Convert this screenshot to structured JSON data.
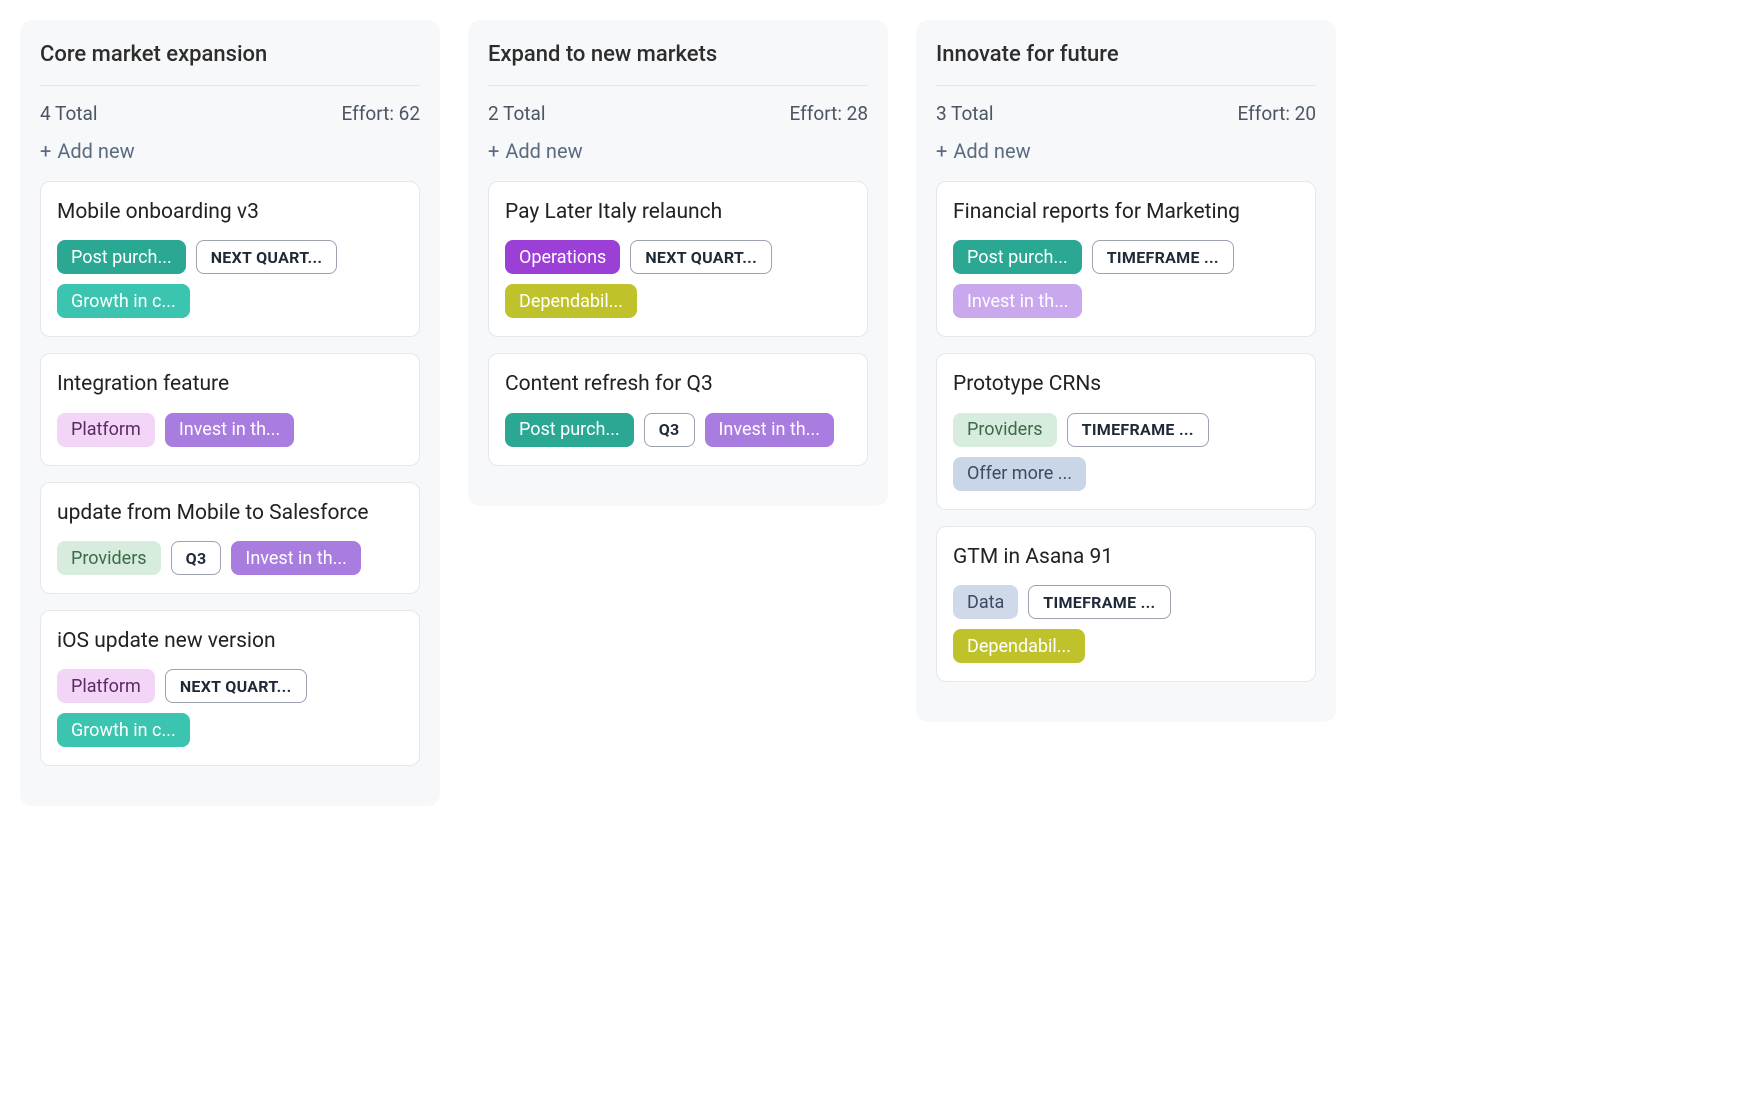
{
  "labels": {
    "add_new": "Add new",
    "total_suffix": "Total",
    "effort_prefix": "Effort:"
  },
  "columns": [
    {
      "title": "Core market expansion",
      "total": 4,
      "effort": 62,
      "cards": [
        {
          "title": "Mobile onboarding v3",
          "tags": [
            {
              "text": "Post purch...",
              "variant": "teal"
            },
            {
              "text": "NEXT QUART...",
              "variant": "outline"
            },
            {
              "text": "Growth in c...",
              "variant": "mint"
            }
          ]
        },
        {
          "title": "Integration feature",
          "tags": [
            {
              "text": "Platform",
              "variant": "pink"
            },
            {
              "text": "Invest in th...",
              "variant": "purple"
            }
          ]
        },
        {
          "title": "update from Mobile to Salesforce",
          "tags": [
            {
              "text": "Providers",
              "variant": "green-lt"
            },
            {
              "text": "Q3",
              "variant": "outline small-outline"
            },
            {
              "text": "Invest in th...",
              "variant": "purple"
            }
          ]
        },
        {
          "title": "iOS update new version",
          "tags": [
            {
              "text": "Platform",
              "variant": "pink"
            },
            {
              "text": "NEXT QUART...",
              "variant": "outline"
            },
            {
              "text": "Growth in c...",
              "variant": "mint"
            }
          ]
        }
      ]
    },
    {
      "title": "Expand to new markets",
      "total": 2,
      "effort": 28,
      "cards": [
        {
          "title": "Pay Later Italy relaunch",
          "tags": [
            {
              "text": "Operations",
              "variant": "violet"
            },
            {
              "text": "NEXT QUART...",
              "variant": "outline"
            },
            {
              "text": "Dependabil...",
              "variant": "olive"
            }
          ]
        },
        {
          "title": "Content refresh for Q3",
          "tags": [
            {
              "text": "Post purch...",
              "variant": "teal"
            },
            {
              "text": "Q3",
              "variant": "outline small-outline"
            },
            {
              "text": "Invest in th...",
              "variant": "purple"
            }
          ]
        }
      ]
    },
    {
      "title": "Innovate for future",
      "total": 3,
      "effort": 20,
      "cards": [
        {
          "title": "Financial reports for Marketing",
          "tags": [
            {
              "text": "Post purch...",
              "variant": "teal"
            },
            {
              "text": "TIMEFRAME ...",
              "variant": "outline"
            },
            {
              "text": "Invest in th...",
              "variant": "purple-lt"
            }
          ]
        },
        {
          "title": "Prototype CRNs",
          "tags": [
            {
              "text": "Providers",
              "variant": "green-lt"
            },
            {
              "text": "TIMEFRAME ...",
              "variant": "outline"
            },
            {
              "text": "Offer more ...",
              "variant": "blue-soft"
            }
          ]
        },
        {
          "title": "GTM in Asana 91",
          "tags": [
            {
              "text": "Data",
              "variant": "blue-lt"
            },
            {
              "text": "TIMEFRAME ...",
              "variant": "outline"
            },
            {
              "text": "Dependabil...",
              "variant": "olive"
            }
          ]
        }
      ]
    }
  ]
}
